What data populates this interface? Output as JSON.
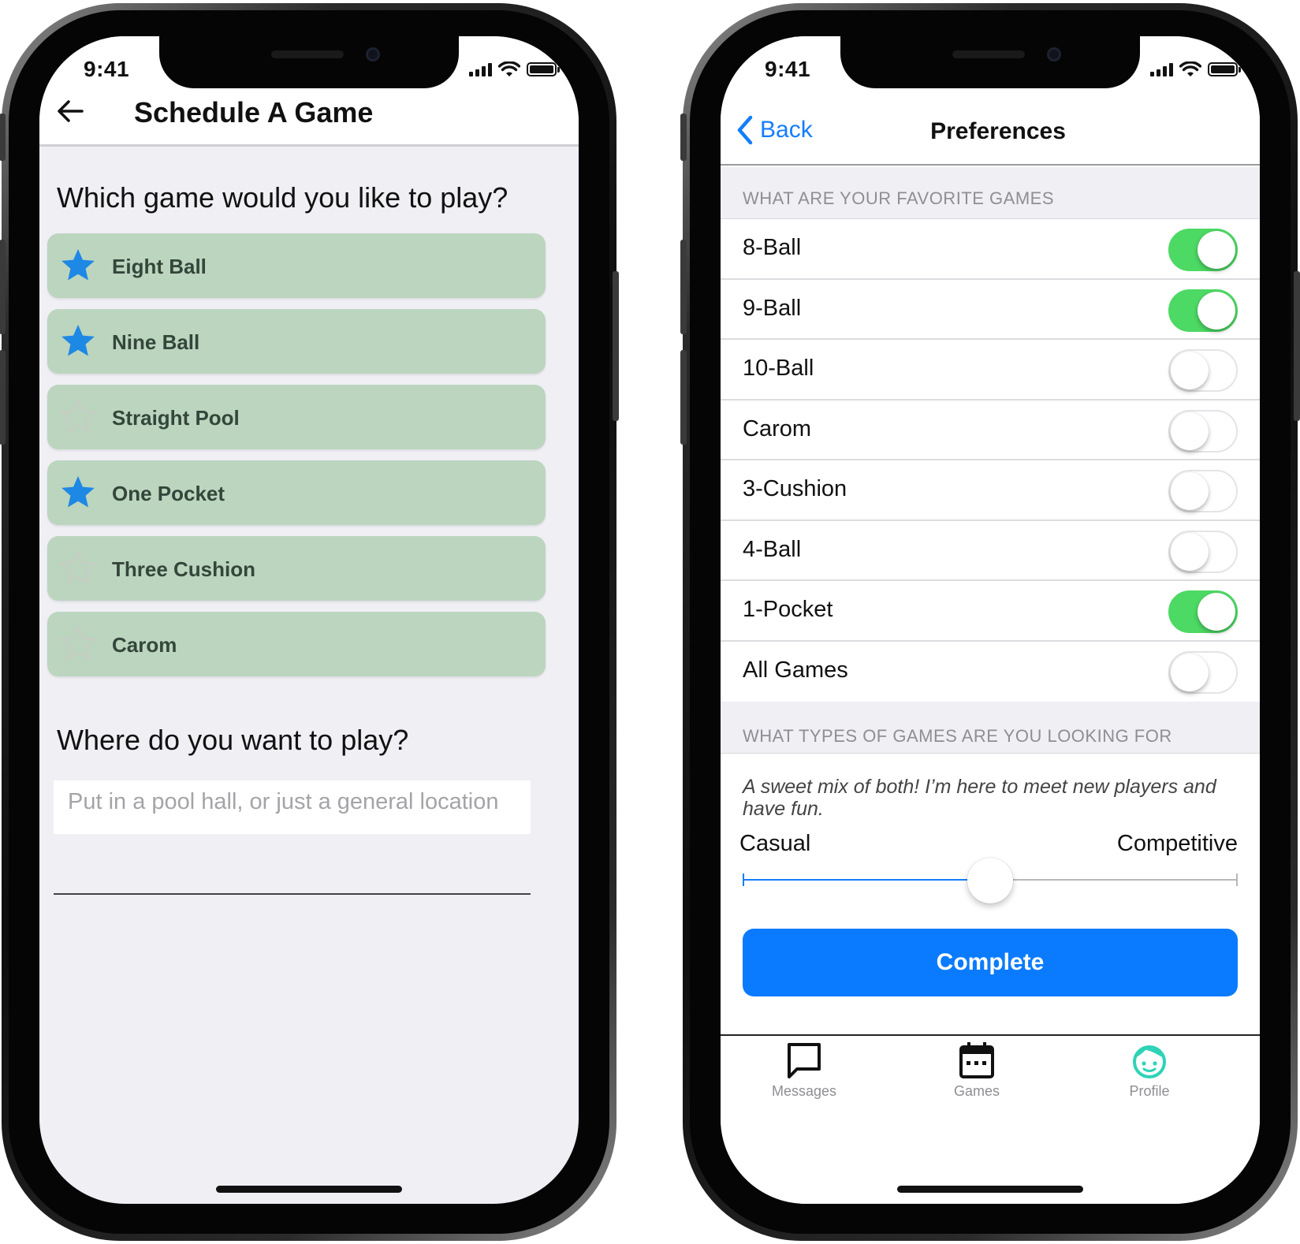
{
  "left_phone": {
    "status": {
      "time": "9:41"
    },
    "header": {
      "title": "Schedule A Game",
      "back_icon": "arrow-left-icon"
    },
    "game_question": "Which game would you like to play?",
    "games": [
      {
        "label": "Eight Ball",
        "favorite": true
      },
      {
        "label": "Nine Ball",
        "favorite": true
      },
      {
        "label": "Straight Pool",
        "favorite": false
      },
      {
        "label": "One Pocket",
        "favorite": true
      },
      {
        "label": "Three Cushion",
        "favorite": false
      },
      {
        "label": "Carom",
        "favorite": false
      }
    ],
    "location_question": "Where do you want to play?",
    "location_input": {
      "value": "",
      "placeholder": "Put in a pool hall, or just a general location"
    }
  },
  "right_phone": {
    "status": {
      "time": "9:41"
    },
    "header": {
      "back_label": "Back",
      "title": "Preferences"
    },
    "favorites_section": "WHAT ARE YOUR FAVORITE GAMES",
    "preferences": [
      {
        "label": "8-Ball",
        "on": true
      },
      {
        "label": "9-Ball",
        "on": true
      },
      {
        "label": "10-Ball",
        "on": false
      },
      {
        "label": "Carom",
        "on": false
      },
      {
        "label": "3-Cushion",
        "on": false
      },
      {
        "label": "4-Ball",
        "on": false
      },
      {
        "label": "1-Pocket",
        "on": true
      },
      {
        "label": "All Games",
        "on": false
      }
    ],
    "types_section": "WHAT TYPES OF GAMES ARE YOU LOOKING FOR",
    "types_description": "A sweet mix of both! I’m here to meet new players and have fun.",
    "slider": {
      "min_label": "Casual",
      "max_label": "Competitive",
      "value": 0.5
    },
    "complete_label": "Complete",
    "tabs": [
      {
        "label": "Messages",
        "icon": "chat-bubble-icon"
      },
      {
        "label": "Games",
        "icon": "calendar-icon"
      },
      {
        "label": "Profile",
        "icon": "face-icon"
      }
    ]
  },
  "colors": {
    "accent_blue": "#0a7bff",
    "star_blue": "#1e88e5",
    "toggle_green": "#4cd964",
    "game_card_green": "#bcd5bf",
    "profile_teal": "#2ed3b7"
  }
}
